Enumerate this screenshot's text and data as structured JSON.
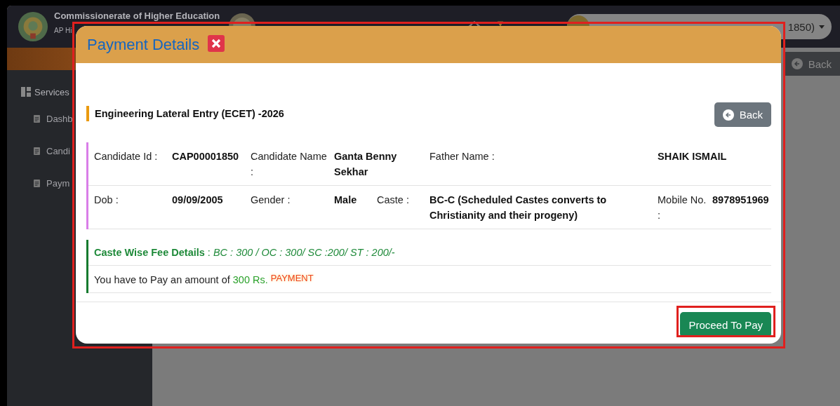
{
  "header": {
    "title": "Commissionerate of Higher Education",
    "subtitle": "AP Hi",
    "user_menu": "1850)"
  },
  "sidebar": {
    "heading": "Services",
    "items": [
      {
        "label": "Dashb"
      },
      {
        "label": "Candi"
      },
      {
        "label": "Paym"
      }
    ]
  },
  "page": {
    "back_button": "Back"
  },
  "modal": {
    "title": "Payment Details",
    "heading": "Engineering Lateral Entry (ECET) -2026",
    "back_button": "Back",
    "details": [
      [
        {
          "kind": "label",
          "text": "Candidate Id :"
        },
        {
          "kind": "value",
          "text": "CAP00001850"
        },
        {
          "kind": "label",
          "text": "Candidate Name :"
        },
        {
          "kind": "wide_value",
          "text": "Ganta Benny Sekhar"
        },
        {
          "kind": "label",
          "text": "Father Name :"
        },
        {
          "kind": "wide_value",
          "text": "SHAIK ISMAIL"
        }
      ],
      [
        {
          "kind": "label",
          "text": "Dob :"
        },
        {
          "kind": "value",
          "text": "09/09/2005"
        },
        {
          "kind": "label",
          "text": "Gender :"
        },
        {
          "kind": "value",
          "text": "Male"
        },
        {
          "kind": "label",
          "text": "Caste :"
        },
        {
          "kind": "value",
          "text": "BC-C (Scheduled Castes converts to Christianity and their progeny)"
        },
        {
          "kind": "label",
          "text": "Mobile No. :"
        },
        {
          "kind": "value",
          "text": "8978951969"
        }
      ]
    ],
    "fee_details": "**Caste Wise Fee Details** : *BC : 300 / OC : 300/ SC :200/ ST : 200/-*",
    "amount_text": "You have to Pay an amount of",
    "amount": "300 Rs.",
    "payment_tag": "PAYMENT",
    "proceed_button": "Proceed To Pay"
  }
}
